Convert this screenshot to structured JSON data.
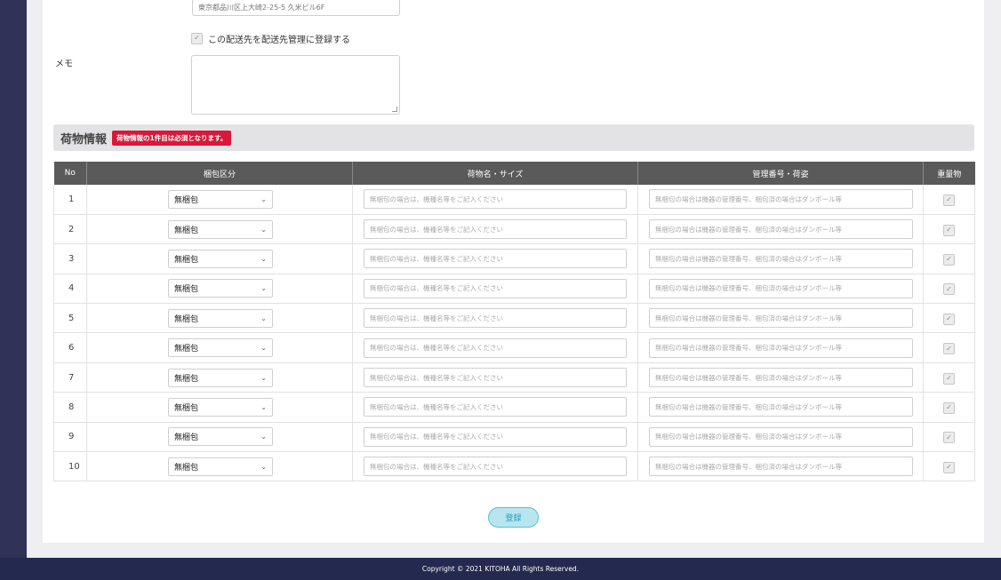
{
  "address": {
    "value": "東京都品川区上大崎2-25-5 久米ビル6F"
  },
  "register_check": {
    "label": "この配送先を配送先管理に登録する",
    "checked": true
  },
  "memo": {
    "label": "メモ",
    "value": ""
  },
  "cargo": {
    "title": "荷物情報",
    "required_note": "荷物情報の1件目は必須となります。",
    "columns": {
      "no": "No",
      "packing": "梱包区分",
      "name": "荷物名・サイズ",
      "mgmt": "管理番号・荷姿",
      "heavy": "重量物"
    },
    "name_placeholder": "無梱包の場合は、機種名等をご記入ください",
    "mgmt_placeholder": "無梱包の場合は機器の管理番号、梱包済の場合はダンボール等",
    "rows": [
      {
        "no": "1",
        "packing": "無梱包"
      },
      {
        "no": "2",
        "packing": "無梱包"
      },
      {
        "no": "3",
        "packing": "無梱包"
      },
      {
        "no": "4",
        "packing": "無梱包"
      },
      {
        "no": "5",
        "packing": "無梱包"
      },
      {
        "no": "6",
        "packing": "無梱包"
      },
      {
        "no": "7",
        "packing": "無梱包"
      },
      {
        "no": "8",
        "packing": "無梱包"
      },
      {
        "no": "9",
        "packing": "無梱包"
      },
      {
        "no": "10",
        "packing": "無梱包"
      }
    ]
  },
  "submit_label": "登録",
  "footer": {
    "copyright": "Copyright © 2021 KITOHA All Rights Reserved."
  },
  "colors": {
    "accent_red": "#d9183a",
    "header_gray": "#5a5a5a",
    "footer_navy": "#24294f",
    "button_cyan": "#b7e6ef"
  },
  "icons": {
    "check": "checkmark-icon",
    "chevron": "chevron-down-icon"
  }
}
